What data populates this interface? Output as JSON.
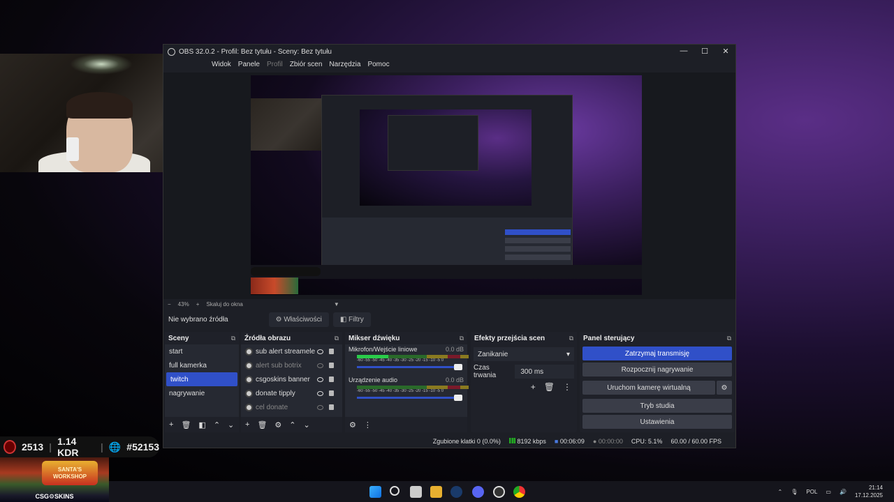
{
  "window": {
    "title": "OBS 32.0.2 - Profil: Bez tytułu - Sceny: Bez tytułu",
    "minimize": "—",
    "maximize": "☐",
    "close": "✕"
  },
  "menu": [
    "Widok",
    "Panele",
    "Profil",
    "Zbiór scen",
    "Narzędzia",
    "Pomoc"
  ],
  "zoom": {
    "minus": "−",
    "value": "43%",
    "plus": "+",
    "mode": "Skaluj do okna"
  },
  "source_bar": {
    "label": "Nie wybrano źródła",
    "properties": "Właściwości",
    "filters": "Filtry"
  },
  "scenes": {
    "title": "Sceny",
    "items": [
      "start",
      "full kamerka",
      "twitch",
      "nagrywanie"
    ],
    "selected": "twitch"
  },
  "sources": {
    "title": "Źródła obrazu",
    "items": [
      {
        "name": "sub alert streamele",
        "visible": true
      },
      {
        "name": "alert sub botrix",
        "visible": false
      },
      {
        "name": "csgoskins banner",
        "visible": true
      },
      {
        "name": "donate tipply",
        "visible": true
      },
      {
        "name": "cel donate",
        "visible": false
      }
    ]
  },
  "mixer": {
    "title": "Mikser dźwięku",
    "channels": [
      {
        "name": "Mikrofon/Wejście liniowe",
        "db": "0.0 dB"
      },
      {
        "name": "Urządzenie audio",
        "db": "0.0 dB"
      }
    ],
    "scale": "-60 -55 -50 -45 -40 -35 -30 -25 -20 -15 -10 -5 0"
  },
  "transitions": {
    "title": "Efekty przejścia scen",
    "type": "Zanikanie",
    "duration_label": "Czas trwania",
    "duration": "300 ms"
  },
  "controls": {
    "title": "Panel sterujący",
    "stop_stream": "Zatrzymaj transmisję",
    "start_record": "Rozpocznij nagrywanie",
    "virtual_cam": "Uruchom kamerę wirtualną",
    "studio_mode": "Tryb studia",
    "settings": "Ustawienia"
  },
  "status": {
    "dropped": "Zgubione klatki 0 (0.0%)",
    "bitrate": "8192 kbps",
    "live_time": "00:06:09",
    "rec_time": "00:00:00",
    "cpu": "CPU: 5.1%",
    "fps": "60.00 / 60.00 FPS"
  },
  "overlay": {
    "stat1": "2513",
    "stat2": "1.14 KDR",
    "stat3": "#52153"
  },
  "banner": {
    "title": "SANTA'S WORKSHOP",
    "brand": "CSG⚙SKINS"
  },
  "tray": {
    "lang": "POL",
    "time": "21:14",
    "date": "17.12.2025"
  },
  "colors": {
    "accent": "#3050c8",
    "dock_bg": "#262932"
  }
}
